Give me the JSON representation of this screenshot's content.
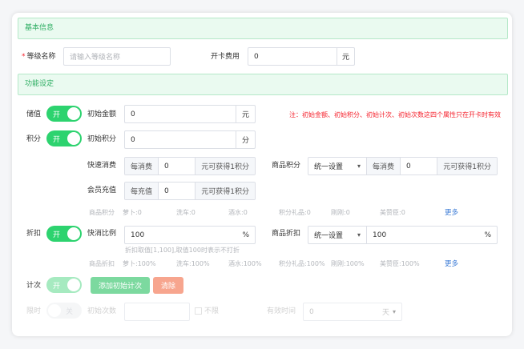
{
  "sections": {
    "basic": "基本信息",
    "func": "功能设定"
  },
  "level_name": {
    "required": "*",
    "label": "等级名称",
    "placeholder": "请输入等级名称"
  },
  "card_fee": {
    "label": "开卡费用",
    "value": "0",
    "unit": "元"
  },
  "stored_value": {
    "label": "储值",
    "switch": "开",
    "init_label": "初始金额",
    "value": "0",
    "unit": "元"
  },
  "note": "注：初始金额、初始积分、初始计次、初始次数这四个属性只在开卡时有效",
  "points": {
    "label": "积分",
    "switch": "开",
    "init_label": "初始积分",
    "init_value": "0",
    "init_unit": "分",
    "quick_label": "快速消费",
    "quick_prefix": "每消费",
    "quick_value": "0",
    "quick_suffix": "元可获得1积分",
    "goods_label": "商品积分",
    "goods_select": "统一设置",
    "goods_prefix": "每消费",
    "goods_value": "0",
    "goods_suffix": "元可获得1积分",
    "recharge_label": "会员充值",
    "recharge_prefix": "每充值",
    "recharge_value": "0",
    "recharge_suffix": "元可获得1积分",
    "goods_row": [
      "商品积分",
      "萝卜:0",
      "洗车:0",
      "酒水:0",
      "积分礼品:0",
      "刚刚:0",
      "美赞臣:0"
    ],
    "more": "更多"
  },
  "discount": {
    "label": "折扣",
    "switch": "开",
    "quick_label": "快消比例",
    "quick_value": "100",
    "quick_unit": "%",
    "hint": "折扣取值[1,100],取值100时表示不打折",
    "goods_label": "商品折扣",
    "goods_select": "统一设置",
    "goods_value": "100",
    "goods_unit": "%",
    "goods_row": [
      "商品折扣",
      "萝卜:100%",
      "洗车:100%",
      "酒水:100%",
      "积分礼品:100%",
      "刚刚:100%",
      "美赞臣:100%"
    ],
    "more": "更多"
  },
  "count": {
    "label": "计次",
    "switch": "开",
    "add_button": "添加初始计次",
    "clear_button": "清除"
  },
  "timed": {
    "label": "限时",
    "switch": "关",
    "init_label": "初始次数",
    "unlimited": "不限",
    "valid_label": "有效时间",
    "valid_value": "0",
    "valid_unit": "天"
  }
}
